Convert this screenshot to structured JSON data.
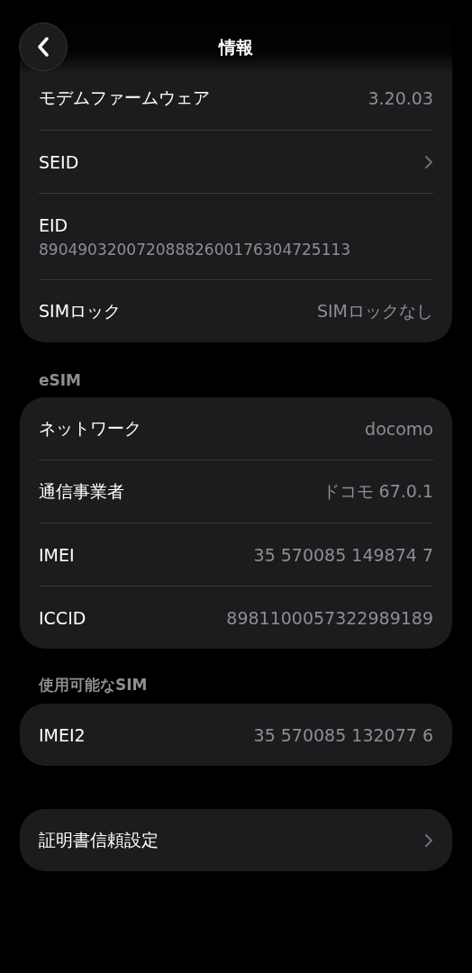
{
  "nav": {
    "title": "情報"
  },
  "sections": [
    {
      "rows": [
        {
          "kind": "value",
          "label": "モデムファームウェア",
          "value": "3.20.03"
        },
        {
          "kind": "chevron",
          "label": "SEID"
        },
        {
          "kind": "stacked",
          "label": "EID",
          "value": "89049032007208882600176304725113"
        },
        {
          "kind": "value",
          "label": "SIMロック",
          "value": "SIMロックなし"
        }
      ]
    },
    {
      "header": "eSIM",
      "rows": [
        {
          "kind": "value",
          "label": "ネットワーク",
          "value": "docomo"
        },
        {
          "kind": "value",
          "label": "通信事業者",
          "value": "ドコモ 67.0.1"
        },
        {
          "kind": "value",
          "label": "IMEI",
          "value": "35 570085 149874 7"
        },
        {
          "kind": "value",
          "label": "ICCID",
          "value": "8981100057322989189"
        }
      ]
    },
    {
      "header": "使用可能なSIM",
      "rows": [
        {
          "kind": "value",
          "label": "IMEI2",
          "value": "35 570085 132077 6"
        }
      ]
    },
    {
      "rows": [
        {
          "kind": "chevron",
          "label": "証明書信頼設定"
        }
      ]
    }
  ]
}
